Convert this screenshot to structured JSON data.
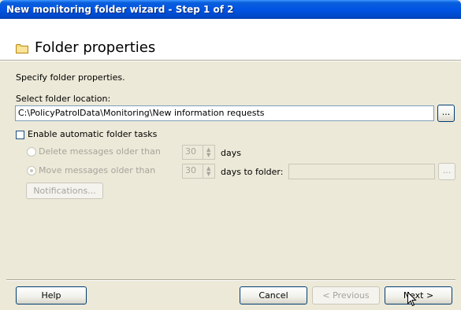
{
  "window": {
    "title": "New monitoring folder wizard - Step 1 of 2"
  },
  "header": {
    "heading": "Folder properties",
    "icon": "folder-icon"
  },
  "form": {
    "instructions": "Specify folder properties.",
    "location_label": "Select folder location:",
    "location_value": "C:\\PolicyPatrolData\\Monitoring\\New information requests",
    "browse_label": "...",
    "enable_tasks_label": "Enable automatic folder tasks",
    "enable_tasks_checked": false,
    "delete_label": "Delete messages older than",
    "delete_days_value": "30",
    "delete_days_unit": "days",
    "move_label": "Move messages older than",
    "move_days_value": "30",
    "move_days_unit": "days to folder:",
    "move_folder_value": "",
    "move_browse_label": "...",
    "notifications_label": "Notifications..."
  },
  "footer": {
    "help_label": "Help",
    "cancel_label": "Cancel",
    "previous_label": "< Previous",
    "next_label": "Next >"
  },
  "colors": {
    "title_bar": "#0054e3",
    "dialog_bg": "#ece9d8",
    "disabled_text": "#a6a49b"
  }
}
